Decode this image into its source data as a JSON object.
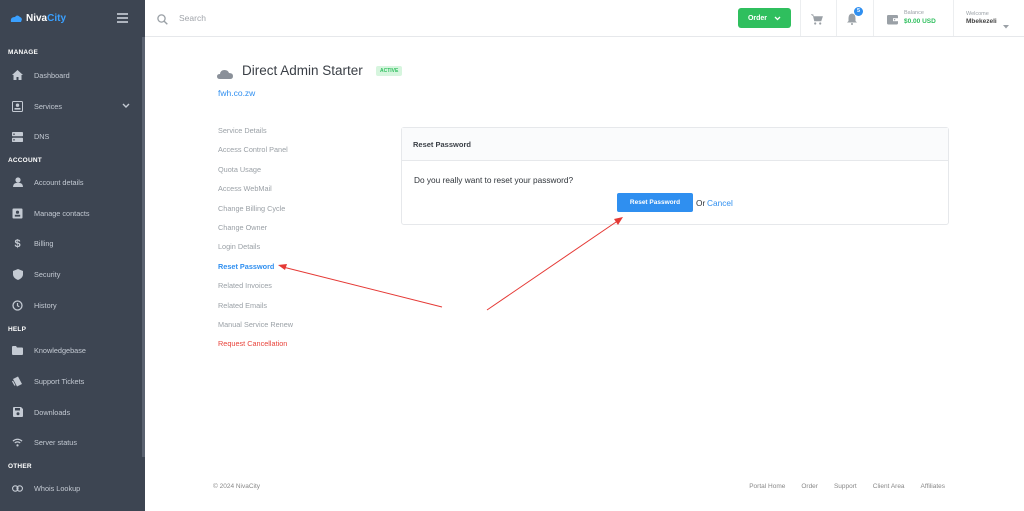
{
  "sidebar": {
    "logo": {
      "part1": "Niva",
      "part2": "City"
    },
    "sections": [
      {
        "label": "MANAGE",
        "items": [
          {
            "label": "Dashboard",
            "icon": "home-icon"
          },
          {
            "label": "Services",
            "icon": "id-card-icon",
            "has_children": true
          },
          {
            "label": "DNS",
            "icon": "server-icon"
          }
        ]
      },
      {
        "label": "ACCOUNT",
        "items": [
          {
            "label": "Account details",
            "icon": "user-icon"
          },
          {
            "label": "Manage contacts",
            "icon": "contacts-icon"
          },
          {
            "label": "Billing",
            "icon": "dollar-icon"
          },
          {
            "label": "Security",
            "icon": "shield-icon"
          },
          {
            "label": "History",
            "icon": "history-icon"
          }
        ]
      },
      {
        "label": "HELP",
        "items": [
          {
            "label": "Knowledgebase",
            "icon": "folder-icon"
          },
          {
            "label": "Support Tickets",
            "icon": "tickets-icon"
          },
          {
            "label": "Downloads",
            "icon": "save-icon"
          },
          {
            "label": "Server status",
            "icon": "wifi-icon"
          }
        ]
      },
      {
        "label": "OTHER",
        "items": [
          {
            "label": "Whois Lookup",
            "icon": "link-icon"
          }
        ]
      }
    ]
  },
  "topbar": {
    "search_placeholder": "Search",
    "order_label": "Order",
    "notifications_count": "5",
    "balance_label": "Balance",
    "balance_value": "$0.00 USD",
    "welcome_label": "Welcome",
    "user_name": "Mbekezeli"
  },
  "service": {
    "title": "Direct Admin Starter",
    "status": "ACTIVE",
    "domain": "fwh.co.zw"
  },
  "service_menu": [
    {
      "label": "Service Details",
      "state": "normal"
    },
    {
      "label": "Access Control Panel",
      "state": "normal"
    },
    {
      "label": "Quota Usage",
      "state": "normal"
    },
    {
      "label": "Access WebMail",
      "state": "normal"
    },
    {
      "label": "Change Billing Cycle",
      "state": "normal"
    },
    {
      "label": "Change Owner",
      "state": "normal"
    },
    {
      "label": "Login Details",
      "state": "normal"
    },
    {
      "label": "Reset Password",
      "state": "active"
    },
    {
      "label": "Related Invoices",
      "state": "normal"
    },
    {
      "label": "Related Emails",
      "state": "normal"
    },
    {
      "label": "Manual Service Renew",
      "state": "normal"
    },
    {
      "label": "Request Cancellation",
      "state": "danger"
    }
  ],
  "reset_card": {
    "header": "Reset Password",
    "question": "Do you really want to reset your password?",
    "confirm_label": "Reset Password",
    "or_text": "Or",
    "cancel_label": "Cancel"
  },
  "footer": {
    "copyright": "© 2024 NivaCity",
    "links": [
      "Portal Home",
      "Order",
      "Support",
      "Client Area",
      "Affiliates"
    ]
  },
  "colors": {
    "sidebar_bg": "#3d4552",
    "accent_blue": "#2f8ff0",
    "success_green": "#2fbf5e",
    "danger_red": "#e8433b",
    "annotation_red": "#e53935"
  }
}
